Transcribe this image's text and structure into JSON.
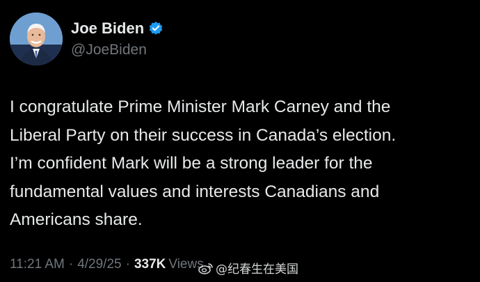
{
  "author": {
    "display_name": "Joe Biden",
    "handle": "@JoeBiden",
    "verified": true,
    "verified_color": "#1d9bf0",
    "avatar_icon": "portrait-avatar"
  },
  "tweet": {
    "lines": [
      "I congratulate Prime Minister Mark Carney and the",
      "Liberal Party on their success in Canada’s election.",
      "I’m confident Mark will be a strong leader for the",
      "fundamental values and interests Canadians and",
      "Americans share."
    ]
  },
  "meta": {
    "time": "11:21 AM",
    "separator": "·",
    "date": "4/29/25",
    "views_count": "337K",
    "views_label": "Views"
  },
  "watermark": {
    "icon": "weibo-logo-icon",
    "text": "@纪春生在美国"
  },
  "colors": {
    "background": "#000000",
    "primary_text": "#e7e9ea",
    "secondary_text": "#71767b"
  }
}
